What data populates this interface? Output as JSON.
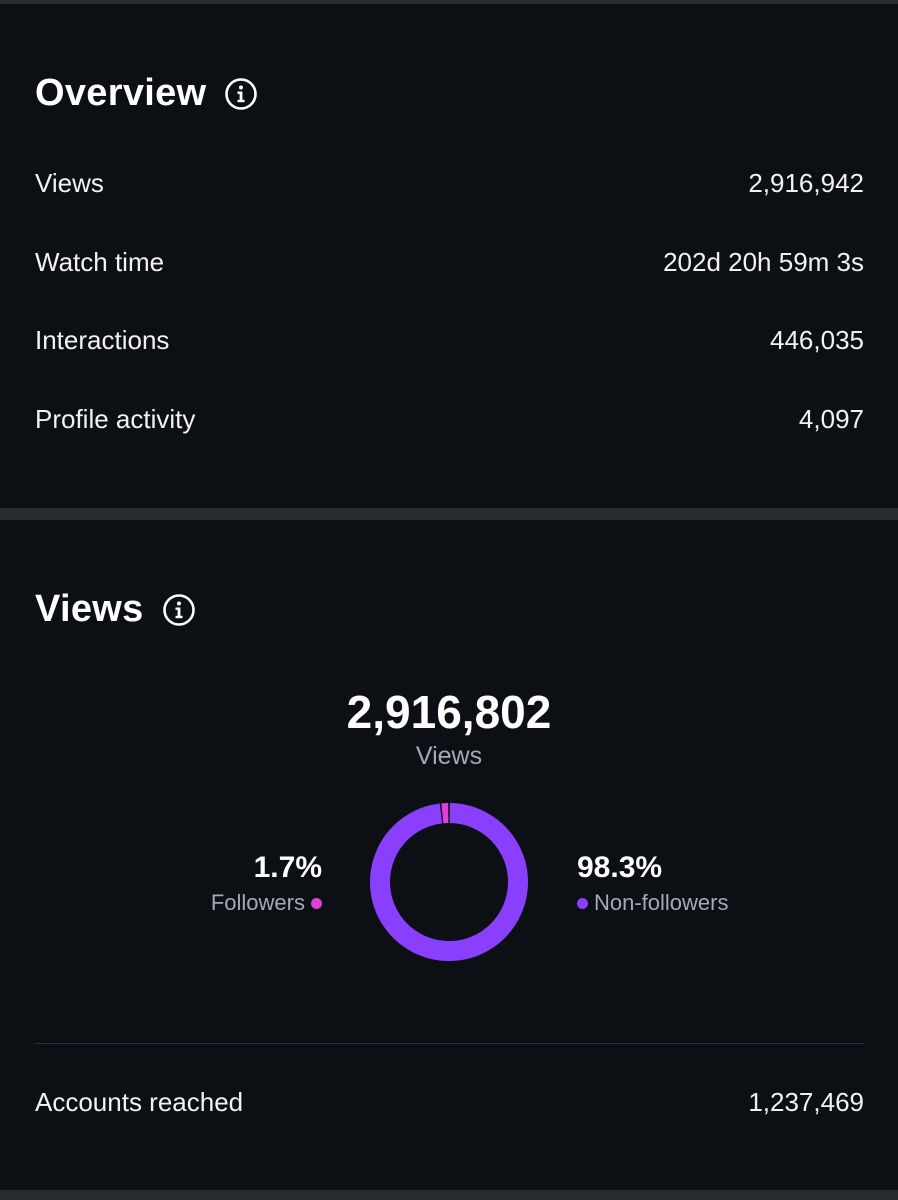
{
  "overview": {
    "title": "Overview",
    "rows": [
      {
        "label": "Views",
        "value": "2,916,942"
      },
      {
        "label": "Watch time",
        "value": "202d 20h 59m 3s"
      },
      {
        "label": "Interactions",
        "value": "446,035"
      },
      {
        "label": "Profile activity",
        "value": "4,097"
      }
    ]
  },
  "views": {
    "title": "Views",
    "total": "2,916,802",
    "total_caption": "Views",
    "followers": {
      "percent_label": "1.7%",
      "label": "Followers",
      "percent": 1.7,
      "color": "#e040d8"
    },
    "non_followers": {
      "percent_label": "98.3%",
      "label": "Non-followers",
      "percent": 98.3,
      "color": "#8a3ffc"
    },
    "accounts_reached": {
      "label": "Accounts reached",
      "value": "1,237,469"
    }
  },
  "icons": {
    "info": "info-circle-icon"
  }
}
